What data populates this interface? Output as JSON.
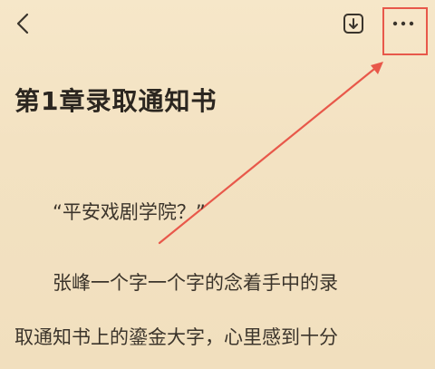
{
  "toolbar": {
    "back_icon": "chevron-left-icon",
    "download_icon": "download-icon",
    "more_icon": "more-horizontal-icon"
  },
  "annotation": {
    "highlight_color": "#e8584a"
  },
  "reader": {
    "chapter_title": "第1章录取通知书",
    "paragraphs": [
      "“平安戏剧学院？”",
      "张峰一个字一个字的念着手中的录",
      "取通知书上的鎏金大字，心里感到十分"
    ]
  }
}
